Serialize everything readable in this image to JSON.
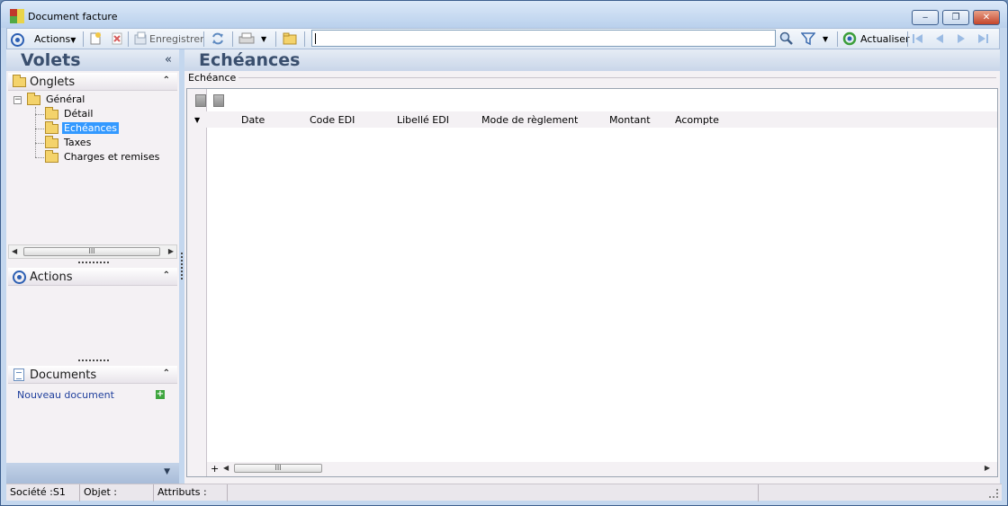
{
  "window": {
    "title": "Document facture",
    "minimize_label": "‒",
    "restore_label": "❐",
    "close_label": "✕"
  },
  "toolbar": {
    "actions_label": "Actions",
    "save_label": "Enregistrer",
    "search_value": "",
    "refresh_label": "Actualiser"
  },
  "left_pane": {
    "title": "Volets",
    "collapse_label": "«",
    "sections": {
      "tabs_title": "Onglets",
      "actions_title": "Actions",
      "documents_title": "Documents"
    },
    "tree": {
      "root": "Général",
      "items": [
        "Détail",
        "Echéances",
        "Taxes",
        "Charges et remises"
      ],
      "selected": "Echéances"
    },
    "scroll_thumb": "III",
    "new_document_link": "Nouveau document",
    "section_toggle": "⌃"
  },
  "right_pane": {
    "title": "Echéances",
    "group_label": "Echéance",
    "columns": [
      "Date",
      "Code EDI",
      "Libellé EDI",
      "Mode de règlement",
      "Montant",
      "Acompte"
    ],
    "scroll_thumb": "III",
    "add_row_label": "+"
  },
  "statusbar": {
    "societe": "Société :S1",
    "objet": "Objet :",
    "attributs": "Attributs :"
  },
  "colors": {
    "window_bg": "#c4d7ee",
    "pane_bg": "#f4f1f4",
    "selection": "#3399ff",
    "header_text": "#3a4f6e",
    "link": "#1f3f9c"
  },
  "icons": [
    "app-icon",
    "target-icon",
    "new-icon",
    "delete-icon",
    "save-icon",
    "refresh-icon",
    "print-icon",
    "folder-icon",
    "search-icon",
    "filter-icon",
    "refresh-green-icon",
    "first-icon",
    "prev-icon",
    "next-icon",
    "last-icon"
  ]
}
